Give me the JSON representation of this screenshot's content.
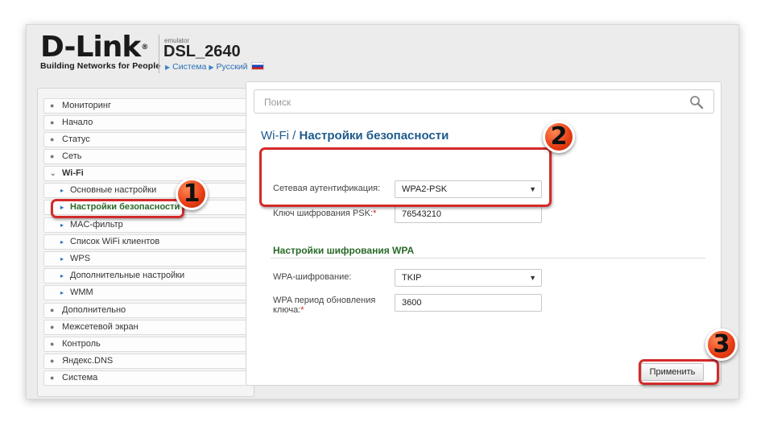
{
  "header": {
    "logo_text": "D-Link",
    "logo_registered": "®",
    "logo_tagline": "Building Networks for People",
    "emulator_label": "emulator",
    "model": "DSL_2640",
    "crumbs": [
      "Система",
      "Русский"
    ]
  },
  "sidebar": {
    "items": [
      {
        "label": "Мониторинг",
        "icon": "circle-bullet-icon"
      },
      {
        "label": "Начало",
        "icon": "circle-bullet-icon"
      },
      {
        "label": "Статус",
        "icon": "circle-bullet-icon"
      },
      {
        "label": "Сеть",
        "icon": "circle-bullet-icon"
      },
      {
        "label": "Wi-Fi",
        "icon": "chevron-down-icon"
      },
      {
        "label": "Основные настройки",
        "icon": "arrow-right-icon"
      },
      {
        "label": "Настройки безопасности",
        "icon": "arrow-right-icon"
      },
      {
        "label": "MAC-фильтр",
        "icon": "arrow-right-icon"
      },
      {
        "label": "Список WiFi клиентов",
        "icon": "arrow-right-icon"
      },
      {
        "label": "WPS",
        "icon": "arrow-right-icon"
      },
      {
        "label": "Дополнительные настройки",
        "icon": "arrow-right-icon"
      },
      {
        "label": "WMM",
        "icon": "arrow-right-icon"
      },
      {
        "label": "Дополнительно",
        "icon": "circle-bullet-icon"
      },
      {
        "label": "Межсетевой экран",
        "icon": "circle-bullet-icon"
      },
      {
        "label": "Контроль",
        "icon": "circle-bullet-icon"
      },
      {
        "label": "Яндекс.DNS",
        "icon": "circle-bullet-icon"
      },
      {
        "label": "Система",
        "icon": "circle-bullet-icon"
      }
    ]
  },
  "search": {
    "placeholder": "Поиск",
    "icon": "search-icon"
  },
  "page": {
    "title_prefix": "Wi-Fi /",
    "title": "Настройки безопасности"
  },
  "form": {
    "auth_label": "Сетевая аутентификация:",
    "auth_value": "WPA2-PSK",
    "psk_label": "Ключ шифрования PSK:",
    "psk_required": "*",
    "psk_value": "76543210",
    "wpa_section_title": "Настройки шифрования WPA",
    "wpa_enc_label": "WPA-шифрование:",
    "wpa_enc_value": "TKIP",
    "wpa_period_label_1": "WPA период обновления",
    "wpa_period_label_2": "ключа:",
    "wpa_period_required": "*",
    "wpa_period_value": "3600"
  },
  "apply_label": "Применить",
  "badges": [
    "1",
    "2",
    "3"
  ],
  "colors": {
    "highlight": "#d42a2a",
    "badge": "#e83c14",
    "accent_green": "#2a6a28",
    "accent_blue": "#1e5a8c"
  }
}
